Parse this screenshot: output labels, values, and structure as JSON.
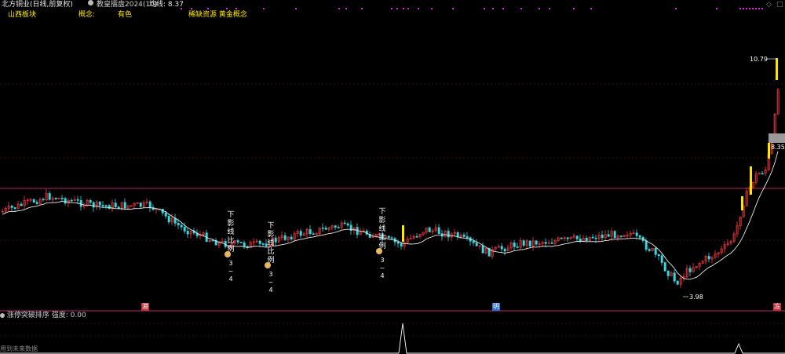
{
  "header": {
    "stock_title": "北方铜业(日线,前复权)",
    "indicator_name": "教皇擂盘2024(10)",
    "ma_label": "均线: 8.37"
  },
  "tags": {
    "sector": "山西板块",
    "concept_label": "概念:",
    "industry": "有色",
    "concepts": "稀缺资源 黄金概念"
  },
  "price_labels": {
    "high": "10.79",
    "current": "8.35",
    "low": "3.98"
  },
  "annotations": {
    "vertical_text": "下影线比例",
    "range": "3~4"
  },
  "markers": {
    "left": "港",
    "middle": "明",
    "right": "冻"
  },
  "subchart": {
    "title": "涨停突破排序",
    "value_label": "强度: 0.00"
  },
  "footer": {
    "note": "用到未来数据"
  },
  "colors": {
    "up": "#ff3b3b",
    "down": "#36d7e0",
    "limit_up": "#ffe600",
    "ma": "#e8e8e8",
    "divider": "#c02070",
    "magenta_dots": "#e020e0"
  }
}
